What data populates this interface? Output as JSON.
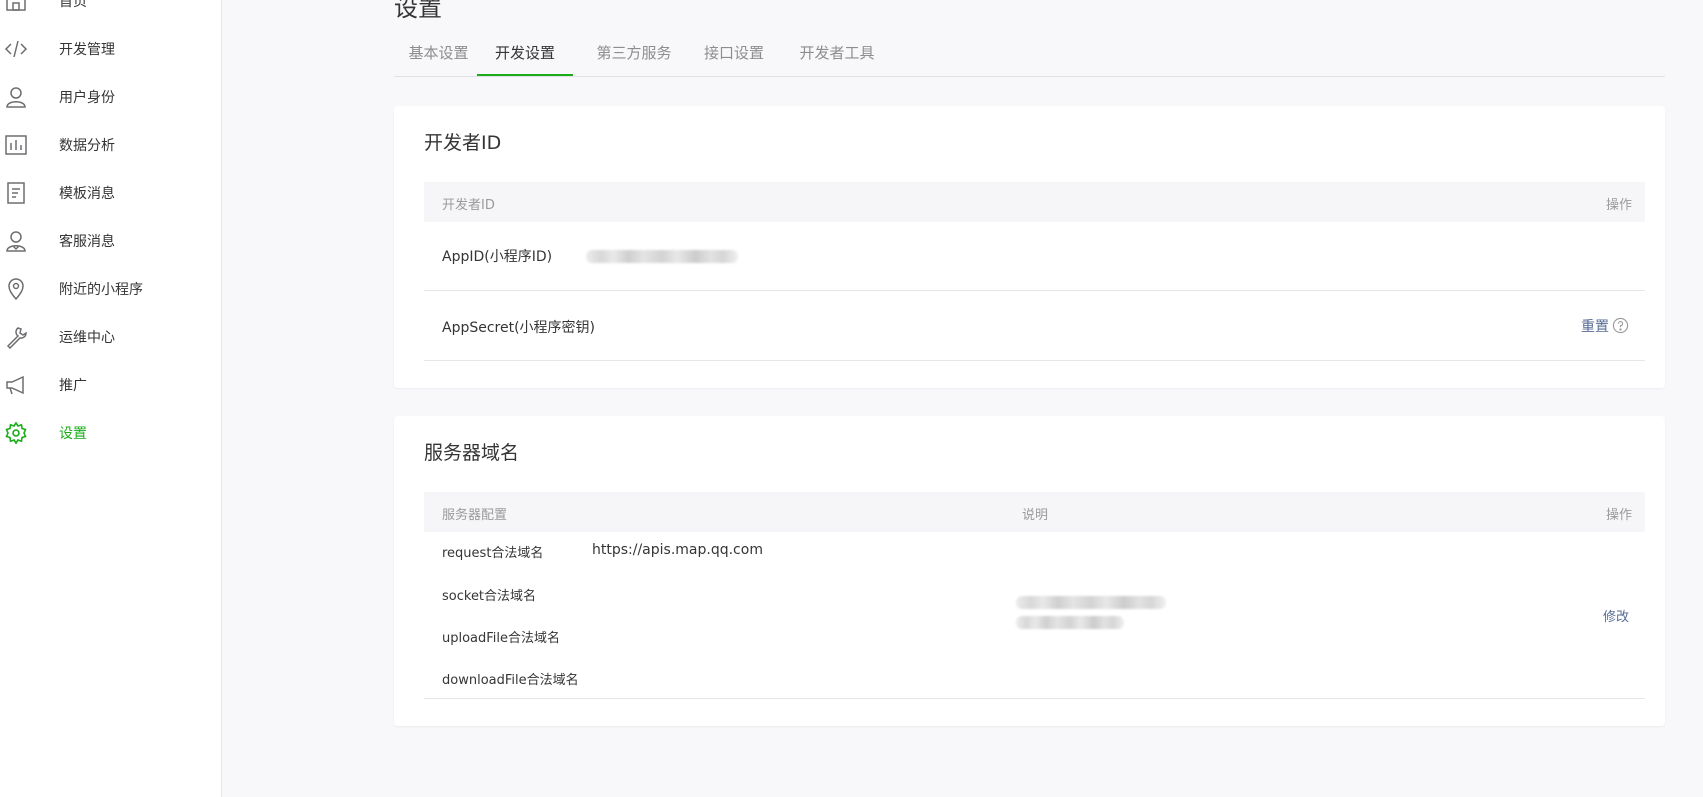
{
  "sidebar": {
    "items": [
      {
        "label": "首页",
        "icon": "home-icon"
      },
      {
        "label": "开发管理",
        "icon": "code-icon"
      },
      {
        "label": "用户身份",
        "icon": "user-icon"
      },
      {
        "label": "数据分析",
        "icon": "chart-icon"
      },
      {
        "label": "模板消息",
        "icon": "document-icon"
      },
      {
        "label": "客服消息",
        "icon": "customer-service-icon"
      },
      {
        "label": "附近的小程序",
        "icon": "location-icon"
      },
      {
        "label": "运维中心",
        "icon": "wrench-icon"
      },
      {
        "label": "推广",
        "icon": "megaphone-icon"
      },
      {
        "label": "设置",
        "icon": "gear-icon",
        "active": true
      }
    ]
  },
  "page": {
    "title": "设置"
  },
  "tabs": [
    {
      "label": "基本设置"
    },
    {
      "label": "开发设置",
      "active": true
    },
    {
      "label": "第三方服务"
    },
    {
      "label": "接口设置"
    },
    {
      "label": "开发者工具"
    }
  ],
  "developer_id": {
    "title": "开发者ID",
    "header": {
      "col1": "开发者ID",
      "action": "操作"
    },
    "rows": [
      {
        "label": "AppID(小程序ID)",
        "value_redacted": true
      },
      {
        "label": "AppSecret(小程序密钥)",
        "action": "重置"
      }
    ]
  },
  "server_domain": {
    "title": "服务器域名",
    "header": {
      "col1": "服务器配置",
      "col2": "说明",
      "action": "操作"
    },
    "rows": [
      {
        "label": "request合法域名",
        "value": "https://apis.map.qq.com"
      },
      {
        "label": "socket合法域名",
        "value": ""
      },
      {
        "label": "uploadFile合法域名",
        "value": ""
      },
      {
        "label": "downloadFile合法域名",
        "value": ""
      }
    ],
    "action": "修改"
  },
  "colors": {
    "accent": "#1aad19",
    "link": "#576b95",
    "page_bg": "#f8f8fa",
    "table_header_bg": "#f6f6f9"
  }
}
